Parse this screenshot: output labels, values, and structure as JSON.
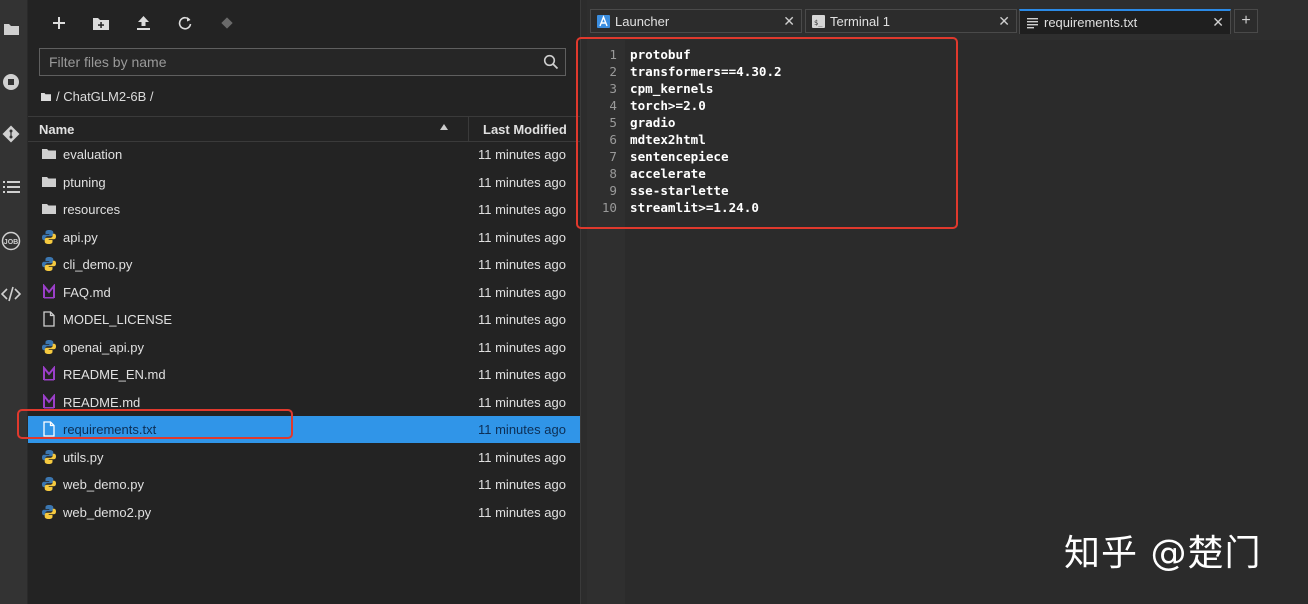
{
  "filebrowser": {
    "filter_placeholder": "Filter files by name",
    "breadcrumb": "/ ChatGLM2-6B /",
    "header_name": "Name",
    "header_modified": "Last Modified",
    "files": [
      {
        "name": "evaluation",
        "type": "folder",
        "modified": "11 minutes ago"
      },
      {
        "name": "ptuning",
        "type": "folder",
        "modified": "11 minutes ago"
      },
      {
        "name": "resources",
        "type": "folder",
        "modified": "11 minutes ago"
      },
      {
        "name": "api.py",
        "type": "python",
        "modified": "11 minutes ago"
      },
      {
        "name": "cli_demo.py",
        "type": "python",
        "modified": "11 minutes ago"
      },
      {
        "name": "FAQ.md",
        "type": "markdown",
        "modified": "11 minutes ago"
      },
      {
        "name": "MODEL_LICENSE",
        "type": "file",
        "modified": "11 minutes ago"
      },
      {
        "name": "openai_api.py",
        "type": "python",
        "modified": "11 minutes ago"
      },
      {
        "name": "README_EN.md",
        "type": "markdown",
        "modified": "11 minutes ago"
      },
      {
        "name": "README.md",
        "type": "markdown",
        "modified": "11 minutes ago"
      },
      {
        "name": "requirements.txt",
        "type": "text",
        "modified": "11 minutes ago",
        "selected": true
      },
      {
        "name": "utils.py",
        "type": "python",
        "modified": "11 minutes ago"
      },
      {
        "name": "web_demo.py",
        "type": "python",
        "modified": "11 minutes ago"
      },
      {
        "name": "web_demo2.py",
        "type": "python",
        "modified": "11 minutes ago"
      }
    ]
  },
  "tabs": [
    {
      "label": "Launcher",
      "icon": "launcher-icon"
    },
    {
      "label": "Terminal 1",
      "icon": "terminal-icon"
    },
    {
      "label": "requirements.txt",
      "icon": "text-file-icon",
      "active": true
    }
  ],
  "editor": {
    "lines": [
      "protobuf",
      "transformers==4.30.2",
      "cpm_kernels",
      "torch>=2.0",
      "gradio",
      "mdtex2html",
      "sentencepiece",
      "accelerate",
      "sse-starlette",
      "streamlit>=1.24.0"
    ]
  },
  "watermark": "知乎 @楚门",
  "colors": {
    "accent": "#2b8ae6",
    "selection": "#3095e8",
    "highlight_box": "#e0392d",
    "python_blue": "#3b76b0",
    "python_yellow": "#f5c93f",
    "markdown_purple": "#9b3fc9"
  }
}
